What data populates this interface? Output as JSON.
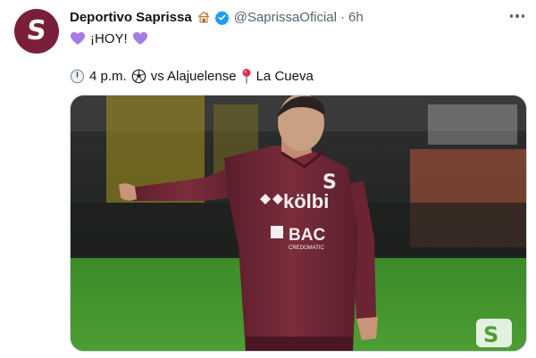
{
  "tweet": {
    "author": {
      "display_name": "Deportivo Saprissa",
      "handle": "@SaprissaOficial",
      "separator": "·",
      "timestamp": "6h",
      "avatar_letter": "S",
      "badge_icons": [
        "house-icon",
        "verified-icon"
      ]
    },
    "text": {
      "line1": "¡HOY!",
      "line2_time": "4 p.m.",
      "line2_opponent": "vs Alajuelense",
      "line2_venue": "La Cueva",
      "line1_icons": [
        "purple-heart-icon",
        "purple-heart-icon"
      ],
      "line2_icons": [
        "clock-icon",
        "soccer-ball-icon",
        "pin-icon"
      ]
    },
    "media": {
      "jersey_sponsor_1": "kölbi",
      "jersey_sponsor_2": "BAC",
      "jersey_sponsor_2_sub": "CREDOMATIC",
      "jersey_crest_letter": "S",
      "watermark_letter": "S"
    },
    "more_icon": "more-icon"
  },
  "colors": {
    "brand_maroon": "#7a1f3a",
    "verified_blue": "#1d9bf0",
    "secondary_text": "#536471",
    "heart_purple": "#a57be6",
    "pitch_green": "#3d8a2a"
  }
}
